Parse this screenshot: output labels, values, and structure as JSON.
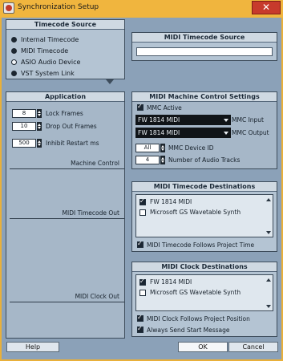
{
  "window": {
    "title": "Synchronization Setup",
    "close_glyph": "✕"
  },
  "timecode_source": {
    "title": "Timecode Source",
    "options": [
      {
        "label": "Internal Timecode",
        "selected": false
      },
      {
        "label": "MIDI Timecode",
        "selected": false
      },
      {
        "label": "ASIO Audio Device",
        "selected": true
      },
      {
        "label": "VST System Link",
        "selected": false
      }
    ]
  },
  "midi_timecode_source": {
    "title": "MIDI Timecode Source",
    "value": ""
  },
  "application": {
    "title": "Application",
    "fields": [
      {
        "value": "8",
        "label": "Lock Frames"
      },
      {
        "value": "10",
        "label": "Drop Out Frames"
      },
      {
        "value": "500",
        "label": "Inhibit Restart ms"
      }
    ],
    "sections": {
      "machine_control": "Machine Control",
      "midi_timecode_out": "MIDI Timecode Out",
      "midi_clock_out": "MIDI Clock Out"
    }
  },
  "mmc": {
    "title": "MIDI Machine Control Settings",
    "active_label": "MMC Active",
    "active": true,
    "input": {
      "value": "FW 1814 MIDI",
      "label": "MMC Input"
    },
    "output": {
      "value": "FW 1814 MIDI",
      "label": "MMC Output"
    },
    "device_id": {
      "value": "All",
      "label": "MMC Device ID"
    },
    "audio_tracks": {
      "value": "4",
      "label": "Number of Audio Tracks"
    }
  },
  "timecode_dest": {
    "title": "MIDI Timecode Destinations",
    "items": [
      {
        "label": "FW 1814 MIDI",
        "checked": true
      },
      {
        "label": "Microsoft GS Wavetable Synth",
        "checked": false
      }
    ],
    "follows_label": "MIDI Timecode Follows Project Time",
    "follows": true
  },
  "clock_dest": {
    "title": "MIDI Clock Destinations",
    "items": [
      {
        "label": "FW 1814 MIDI",
        "checked": true
      },
      {
        "label": "Microsoft GS Wavetable Synth",
        "checked": false
      }
    ],
    "follows_label": "MIDI Clock Follows Project Position",
    "follows": true,
    "start_label": "Always Send Start Message",
    "start": true
  },
  "buttons": {
    "help": "Help",
    "ok": "OK",
    "cancel": "Cancel"
  }
}
